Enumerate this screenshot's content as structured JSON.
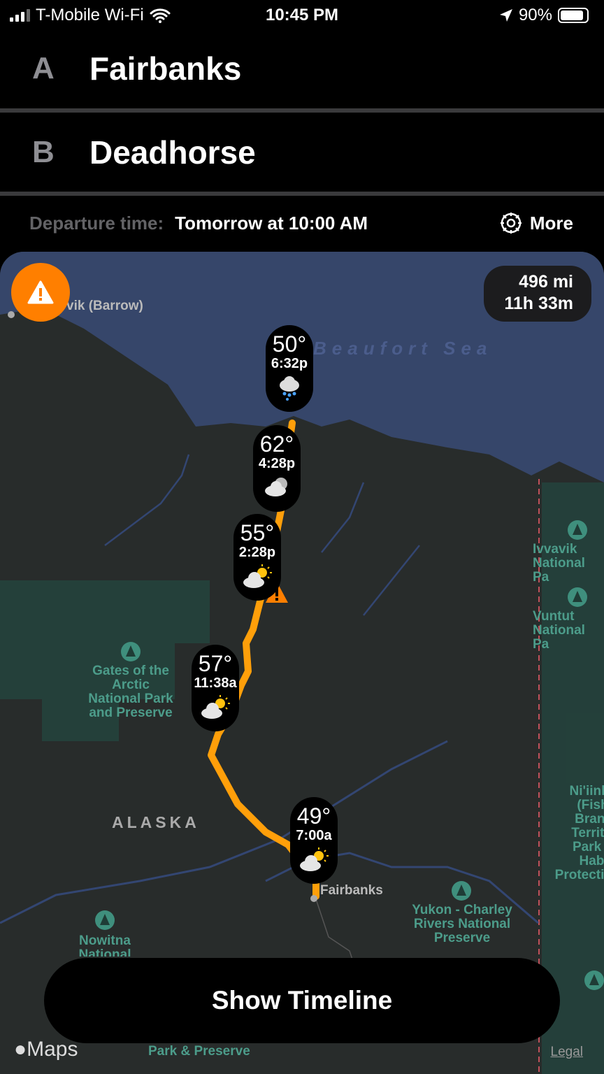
{
  "status_bar": {
    "carrier": "T-Mobile Wi-Fi",
    "time": "10:45 PM",
    "battery": "90%",
    "battery_level": 0.9,
    "signal_bars": 3
  },
  "route": {
    "origin": {
      "letter": "A",
      "name": "Fairbanks"
    },
    "destination": {
      "letter": "B",
      "name": "Deadhorse"
    },
    "departure_label": "Departure time:",
    "departure_value": "Tomorrow at 10:00 AM",
    "more_label": "More"
  },
  "map": {
    "distance": "496 mi",
    "duration": "11h 33m",
    "labels": {
      "barrow": "vik (Barrow)",
      "sea": "Beaufort Sea",
      "ivvavik": "Ivvavik\nNational Pa",
      "vuntut": "Vuntut\nNational Pa",
      "gates": "Gates of the\nArctic\nNational Park\nand Preserve",
      "alaska": "ALASKA",
      "fairbanks": "Fairbanks",
      "yukon": "Yukon - Charley\nRivers National\nPreserve",
      "nowitna": "Nowitna\nNational",
      "niinlii": "Ni'iinlii\n(Fishi\nBranc\nTerrito\nPark a\nHabit\nProtectio",
      "park_preserve": "Park & Preserve"
    },
    "waypoints": [
      {
        "temp": "50°",
        "time": "6:32p",
        "icon": "rain-cloud-icon"
      },
      {
        "temp": "62°",
        "time": "4:28p",
        "icon": "cloudy-icon"
      },
      {
        "temp": "55°",
        "time": "2:28p",
        "icon": "partly-cloudy-icon"
      },
      {
        "temp": "57°",
        "time": "11:38a",
        "icon": "partly-cloudy-icon"
      },
      {
        "temp": "49°",
        "time": "7:00a",
        "icon": "partly-cloudy-icon"
      }
    ],
    "colors": {
      "route": "#ff9f0a",
      "warning": "#ff7f00",
      "sea": "#36466a",
      "land": "#282c2b",
      "park": "#24403a"
    },
    "attribution": "Maps",
    "legal": "Legal"
  },
  "timeline_button": "Show Timeline"
}
